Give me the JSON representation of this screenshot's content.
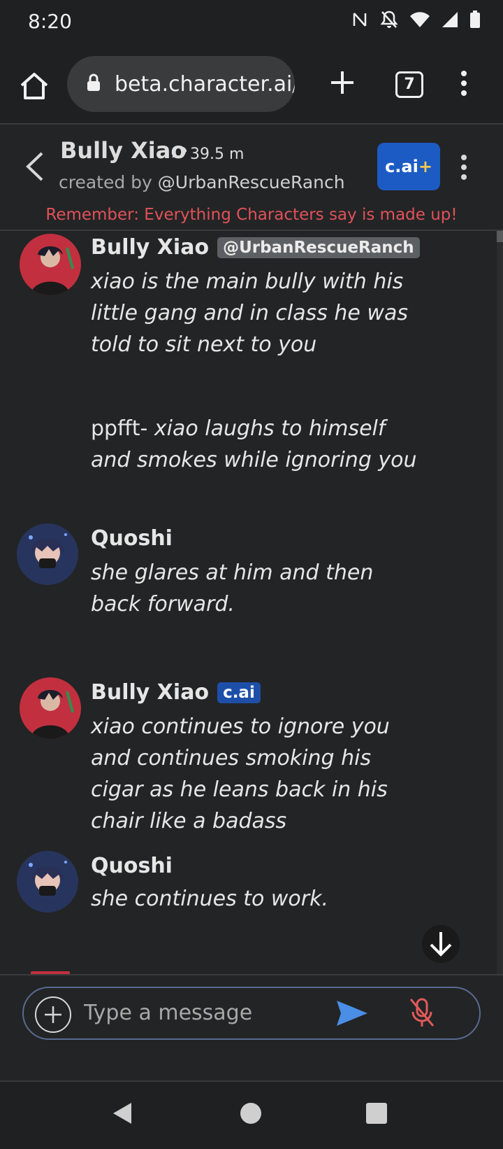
{
  "status_bar": {
    "time": "8:20"
  },
  "browser": {
    "url": "beta.character.ai/",
    "tab_count": "7"
  },
  "character": {
    "name": "Bully Xiao",
    "chat_count": "39.5 m",
    "creator_prefix": "created by",
    "creator_handle": "@UrbanRescueRanch",
    "upgrade_label": "c.ai",
    "upgrade_plus": "+",
    "disclaimer": "Remember: Everything Characters say is made up!"
  },
  "messages": [
    {
      "author": "Bully Xiao",
      "badge": "@UrbanRescueRanch",
      "text1": "xiao is the main bully with his little gang and in class he was told to sit next to you",
      "text2_plain": "ppfft- ",
      "text2_italic": "xiao laughs to himself and smokes while ignoring you"
    },
    {
      "author": "Quoshi",
      "text": "she glares at him and then back forward."
    },
    {
      "author": "Bully Xiao",
      "badge": "c.ai",
      "text": "xiao continues to ignore you and continues smoking his cigar as he leans back in his chair like a badass"
    },
    {
      "author": "Quoshi",
      "text": "she continues to work."
    }
  ],
  "composer": {
    "placeholder": "Type a message"
  },
  "colors": {
    "background": "#232425",
    "accent_blue": "#1c5bc4",
    "warning_red": "#e0525a",
    "send_blue": "#4a8ee6",
    "mic_red": "#e05a5a"
  }
}
